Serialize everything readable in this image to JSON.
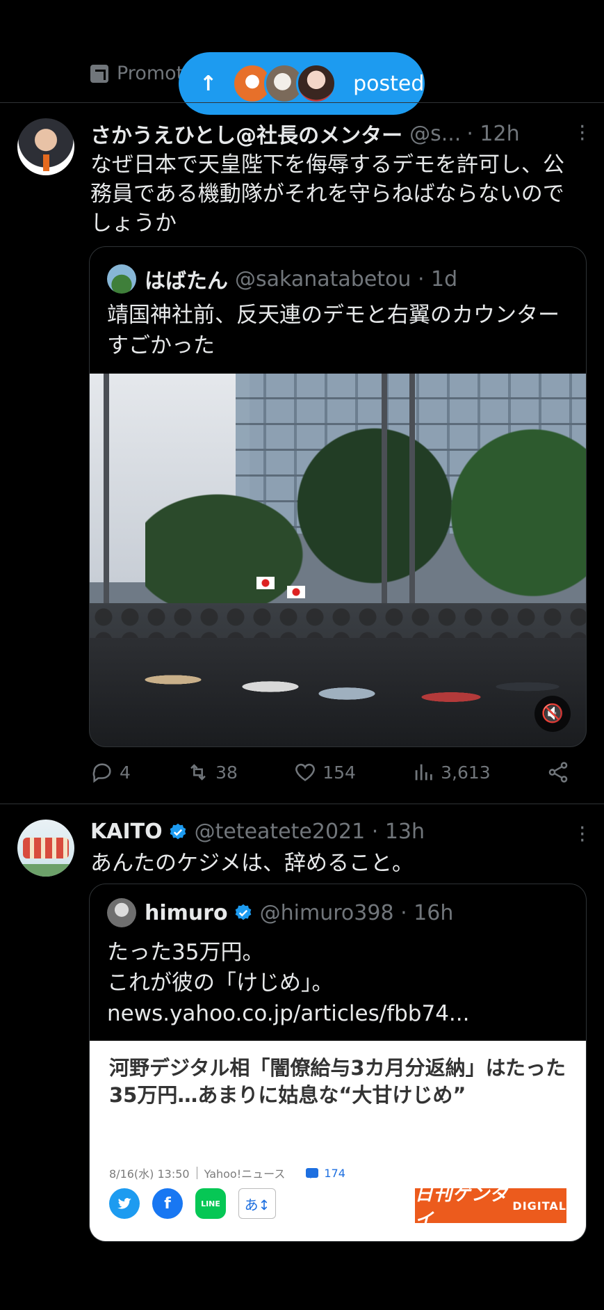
{
  "promo": {
    "label": "Promot"
  },
  "posted_pill": {
    "arrow": "↑",
    "label": "posted"
  },
  "tweets": [
    {
      "name": "さかうえひとし@社長のメンター",
      "handle": "@s...",
      "time": "· 12h",
      "text": "なぜ日本で天皇陛下を侮辱するデモを許可し、公務員である機動隊がそれを守らねばならないのでしょうか",
      "quote": {
        "name": "はばたん",
        "handle": "@sakanatabetou · 1d",
        "text": "靖国神社前、反天連のデモと右翼のカウンターすごかった"
      },
      "actions": {
        "replies": "4",
        "reposts": "38",
        "likes": "154",
        "views": "3,613"
      }
    },
    {
      "name": "KAITO",
      "handle": "@teteatete2021 · 13h",
      "text": "あんたのケジメは、辞めること。",
      "quote": {
        "name": "himuro",
        "handle": "@himuro398 · 16h",
        "text_line1": "たった35万円。",
        "text_line2": "これが彼の「けじめ」。",
        "link": "news.yahoo.co.jp/articles/fbb74...",
        "article": {
          "title": "河野デジタル相「闇僚給与3カ月分返納」はたった35万円…あまりに姑息な“大甘けじめ”",
          "date": "8/16(水) 13:50",
          "source": "Yahoo!ニュース",
          "comments": "174",
          "share_aa": "あ↕",
          "line": "LINE",
          "brand": "日刊ゲンダイ",
          "brand_sub": "DIGITAL"
        }
      }
    }
  ],
  "colors": {
    "accent": "#1d9bf0",
    "muted": "#71767b",
    "bg": "#000000",
    "divider": "#2f3336"
  }
}
